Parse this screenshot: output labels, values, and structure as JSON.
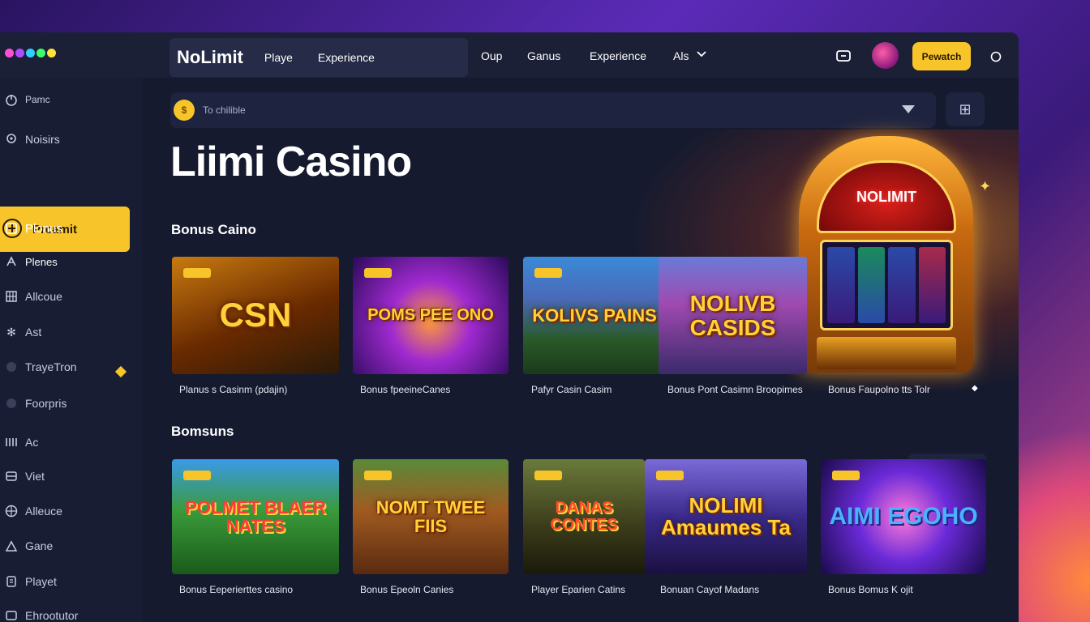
{
  "colors": {
    "accent": "#f7c52a",
    "background": "#151a2e",
    "dots": [
      "#ff4fd8",
      "#b04cff",
      "#2fd0ff",
      "#39ff6a",
      "#ffe23a"
    ]
  },
  "topbar": {
    "brand": "NoLimit",
    "brand_nav": [
      "Playe",
      "Experience"
    ],
    "nav": [
      "Oup",
      "Ganus",
      "Experience",
      "Als"
    ],
    "nav_dropdown_icon": "chevron-down-icon",
    "deposit_button": "Pewatch"
  },
  "sidebar": {
    "items": [
      {
        "label": "Pamc",
        "icon": "power-icon"
      },
      {
        "label": "Noisirs",
        "icon": "pin-icon"
      },
      {
        "label": "Prcamit",
        "icon": "coin-icon",
        "active": true
      },
      {
        "label": "Plonus",
        "icon": "square-icon"
      },
      {
        "label": "Plenes",
        "icon": "plane-icon"
      },
      {
        "label": "Allcoue",
        "icon": "grid-icon"
      },
      {
        "label": "Ast",
        "icon": "gear-icon"
      },
      {
        "label": "TrayeTron",
        "icon": "circle-icon"
      },
      {
        "label": "Foorpris",
        "icon": "circle-icon"
      },
      {
        "label": "Ac",
        "icon": "bars-icon"
      },
      {
        "label": "Viet",
        "icon": "layers-icon"
      },
      {
        "label": "Alleuce",
        "icon": "globe-icon"
      },
      {
        "label": "Gane",
        "icon": "home-icon"
      },
      {
        "label": "Playet",
        "icon": "tag-icon"
      },
      {
        "label": "Ehrootutor",
        "icon": "layers-icon"
      }
    ]
  },
  "search": {
    "placeholder": "To chilible"
  },
  "hero": {
    "title": "Liimi Casino"
  },
  "sections": [
    {
      "title": "Bonus Caino",
      "cards": [
        {
          "art": "CSN",
          "caption": "Planus s Casinm (pdajin)"
        },
        {
          "art": "POMS PEE ONO",
          "caption": "Bonus fpeeineCanes"
        },
        {
          "art": "KOLIVS PAINS",
          "caption": "Pafyr Casin Casim"
        },
        {
          "art": "NOLIVB CASIDS",
          "caption": "Bonus Pont Casimn Broopimes"
        },
        {
          "art": "NOLMIT",
          "caption": "Bonus Faupolno tts Tolr"
        }
      ]
    },
    {
      "title": "Bomsuns",
      "cards": [
        {
          "art": "POLMET BLAER NATES",
          "caption": "Bonus Eeperierttes casino"
        },
        {
          "art": "NOMT TWEE FIIS",
          "caption": "Bonus Epeoln Canies"
        },
        {
          "art": "DANAS CONTES",
          "caption": "Player Eparien Catins"
        },
        {
          "art": "NOLIMI Amaumes Ta",
          "caption": "Bonuan Cayof Madans"
        },
        {
          "art": "AIMI EGOHO",
          "caption": "Bonus Bomus K ojit"
        }
      ]
    }
  ]
}
